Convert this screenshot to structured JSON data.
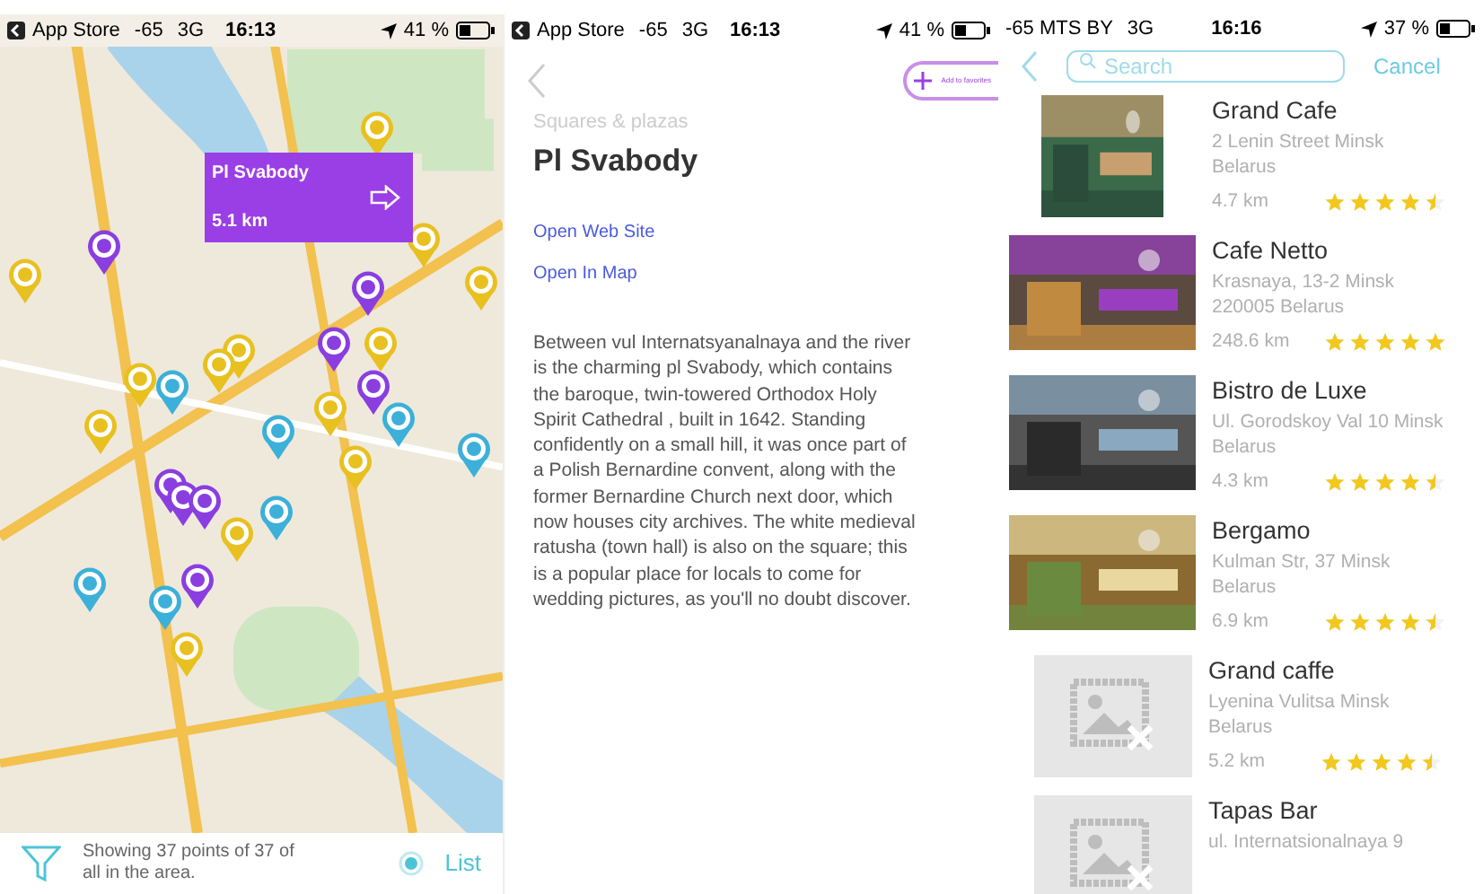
{
  "map_screen": {
    "status_bar": {
      "back_app": "App Store",
      "signal": "-65",
      "network": "3G",
      "time": "16:13",
      "battery": "41 %"
    },
    "callout": {
      "title": "Pl Svabody",
      "distance": "5.1 km"
    },
    "bottom_bar": {
      "summary": "Showing 37 points of 37 of all in the area.",
      "list_button": "List"
    }
  },
  "detail_screen": {
    "status_bar": {
      "back_app": "App Store",
      "signal": "-65",
      "network": "3G",
      "time": "16:13",
      "battery": "41 %"
    },
    "favorite_button": "Add to favorites",
    "category": "Squares & plazas",
    "title": "Pl Svabody",
    "links": [
      "Open Web Site",
      "Open In Map"
    ],
    "description": "Between vul Internatsyanalnaya and the river is the charming pl Svabody, which contains the baroque, twin-towered Orthodox Holy Spirit Cathedral , built in 1642. Standing confidently on a small hill, it was once part of a Polish Bernardine convent, along with the former Bernardine Church next door, which now houses city archives. The white medieval ratusha (town hall) is also on the square; this is a popular place for locals to come for wedding pictures, as you'll no doubt discover."
  },
  "list_screen": {
    "status_bar": {
      "carrier": "-65 MTS BY",
      "network": "3G",
      "time": "16:16",
      "battery": "37 %"
    },
    "search": {
      "placeholder": "Search"
    },
    "cancel": "Cancel",
    "places": [
      {
        "name": "Grand Cafe",
        "address": "2 Lenin Street Minsk Belarus",
        "distance": "4.7 km",
        "stars": 4.5,
        "image": {
          "kind": "photo_square"
        }
      },
      {
        "name": "Cafe Netto",
        "address": "Krasnaya, 13-2 Minsk 220005 Belarus",
        "distance": "248.6 km",
        "stars": 5
      },
      {
        "name": "Bistro de Luxe",
        "address": "Ul. Gorodskoy Val 10 Minsk  Belarus",
        "distance": "4.3 km",
        "stars": 4.5
      },
      {
        "name": "Bergamo",
        "address": "Kulman Str, 37 Minsk Belarus",
        "distance": "6.9 km",
        "stars": 4.5
      },
      {
        "name": "Grand caffe",
        "address": "Lyenina Vulitsa Minsk Belarus",
        "distance": "5.2 km",
        "stars": 4.5,
        "image": {
          "kind": "placeholder"
        }
      },
      {
        "name": "Tapas Bar",
        "address": "ul. Internatsionalnaya 9",
        "image": {
          "kind": "placeholder"
        }
      }
    ]
  }
}
